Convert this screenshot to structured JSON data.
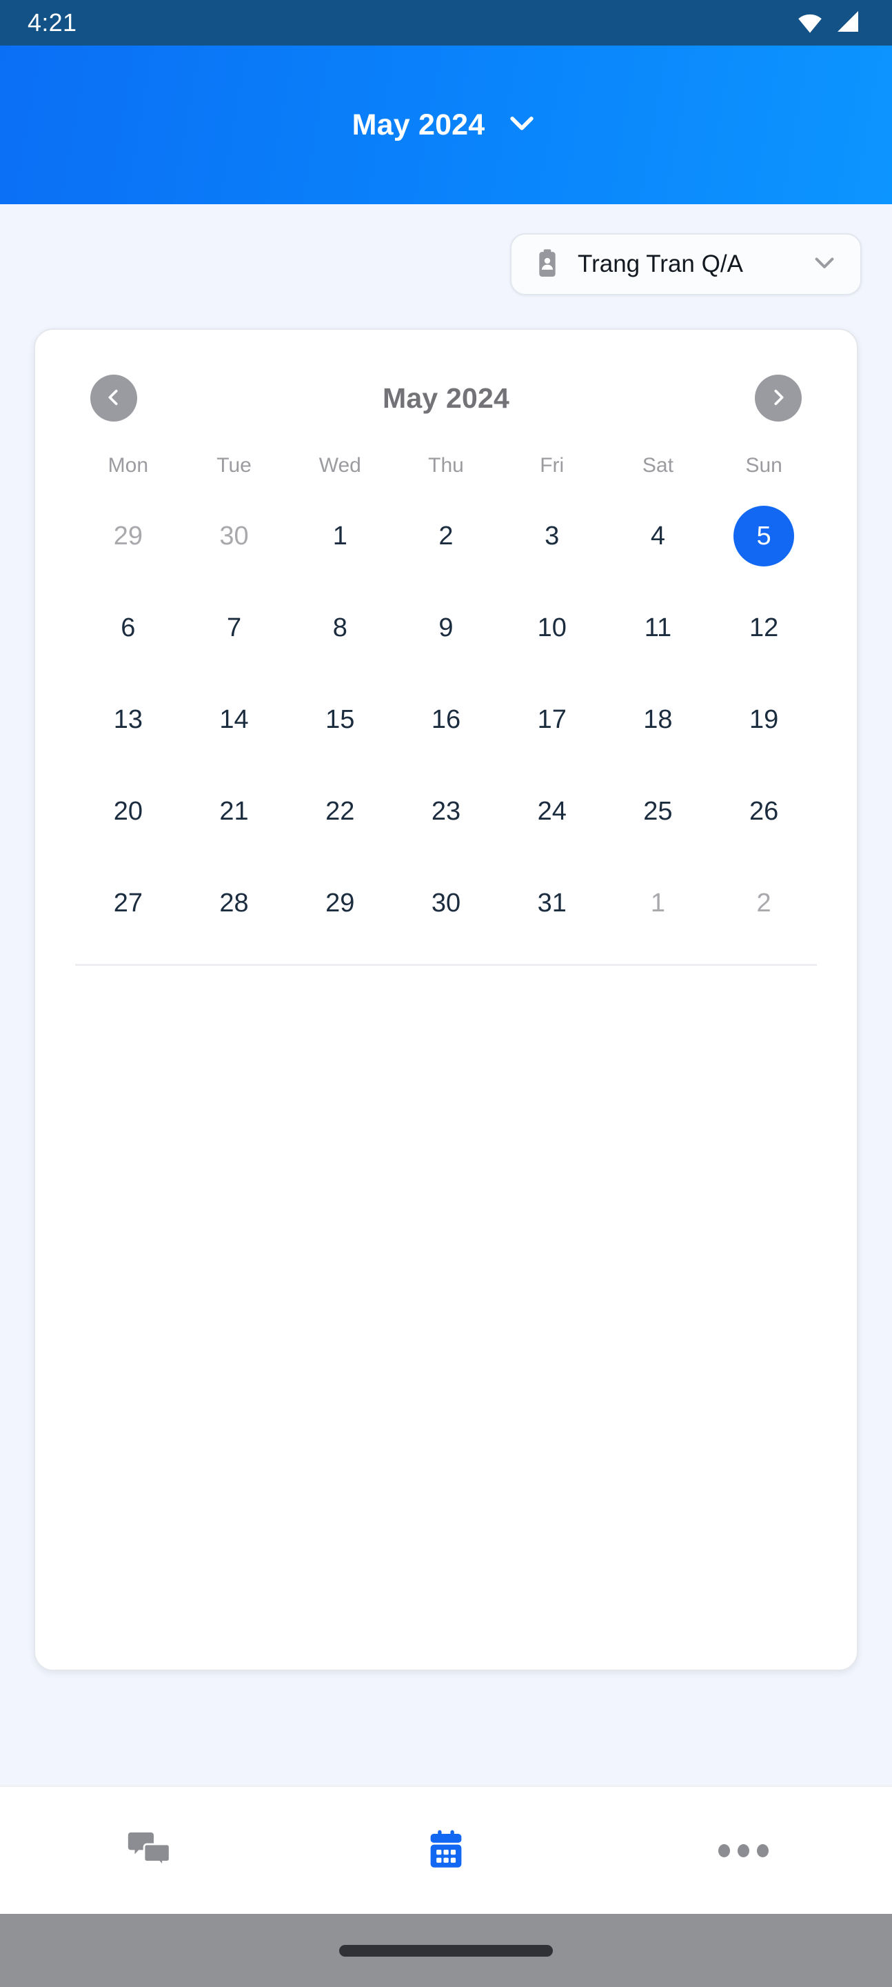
{
  "status_bar": {
    "time": "4:21",
    "icons": [
      "wifi-icon",
      "cellular-signal-icon"
    ],
    "background_color": "#135287"
  },
  "header": {
    "title": "May 2024",
    "chevron": "chevron-down-icon",
    "background_color": "#0a84fb",
    "text_color": "#ffffff"
  },
  "user_selector": {
    "icon": "id-badge-icon",
    "label": "Trang Tran Q/A",
    "chevron": "chevron-down-icon"
  },
  "calendar": {
    "month_title": "May 2024",
    "prev_label": "chevron-left-icon",
    "next_label": "chevron-right-icon",
    "weekdays": [
      "Mon",
      "Tue",
      "Wed",
      "Thu",
      "Fri",
      "Sat",
      "Sun"
    ],
    "selected_day": 5,
    "accent_color": "#1268f3",
    "weeks": [
      [
        {
          "d": "29",
          "muted": true,
          "selected": false
        },
        {
          "d": "30",
          "muted": true,
          "selected": false
        },
        {
          "d": "1",
          "muted": false,
          "selected": false
        },
        {
          "d": "2",
          "muted": false,
          "selected": false
        },
        {
          "d": "3",
          "muted": false,
          "selected": false
        },
        {
          "d": "4",
          "muted": false,
          "selected": false
        },
        {
          "d": "5",
          "muted": false,
          "selected": true
        }
      ],
      [
        {
          "d": "6",
          "muted": false,
          "selected": false
        },
        {
          "d": "7",
          "muted": false,
          "selected": false
        },
        {
          "d": "8",
          "muted": false,
          "selected": false
        },
        {
          "d": "9",
          "muted": false,
          "selected": false
        },
        {
          "d": "10",
          "muted": false,
          "selected": false
        },
        {
          "d": "11",
          "muted": false,
          "selected": false
        },
        {
          "d": "12",
          "muted": false,
          "selected": false
        }
      ],
      [
        {
          "d": "13",
          "muted": false,
          "selected": false
        },
        {
          "d": "14",
          "muted": false,
          "selected": false
        },
        {
          "d": "15",
          "muted": false,
          "selected": false
        },
        {
          "d": "16",
          "muted": false,
          "selected": false
        },
        {
          "d": "17",
          "muted": false,
          "selected": false
        },
        {
          "d": "18",
          "muted": false,
          "selected": false
        },
        {
          "d": "19",
          "muted": false,
          "selected": false
        }
      ],
      [
        {
          "d": "20",
          "muted": false,
          "selected": false
        },
        {
          "d": "21",
          "muted": false,
          "selected": false
        },
        {
          "d": "22",
          "muted": false,
          "selected": false
        },
        {
          "d": "23",
          "muted": false,
          "selected": false
        },
        {
          "d": "24",
          "muted": false,
          "selected": false
        },
        {
          "d": "25",
          "muted": false,
          "selected": false
        },
        {
          "d": "26",
          "muted": false,
          "selected": false
        }
      ],
      [
        {
          "d": "27",
          "muted": false,
          "selected": false
        },
        {
          "d": "28",
          "muted": false,
          "selected": false
        },
        {
          "d": "29",
          "muted": false,
          "selected": false
        },
        {
          "d": "30",
          "muted": false,
          "selected": false
        },
        {
          "d": "31",
          "muted": false,
          "selected": false
        },
        {
          "d": "1",
          "muted": true,
          "selected": false
        },
        {
          "d": "2",
          "muted": true,
          "selected": false
        }
      ]
    ]
  },
  "bottom_nav": {
    "items": [
      {
        "name": "chat-tab",
        "icon": "chat-bubbles-icon",
        "active": false
      },
      {
        "name": "calendar-tab",
        "icon": "calendar-icon",
        "active": true
      },
      {
        "name": "more-tab",
        "icon": "more-horizontal-icon",
        "active": false
      }
    ],
    "active_color": "#1268f3",
    "inactive_color": "#8c8d92"
  }
}
